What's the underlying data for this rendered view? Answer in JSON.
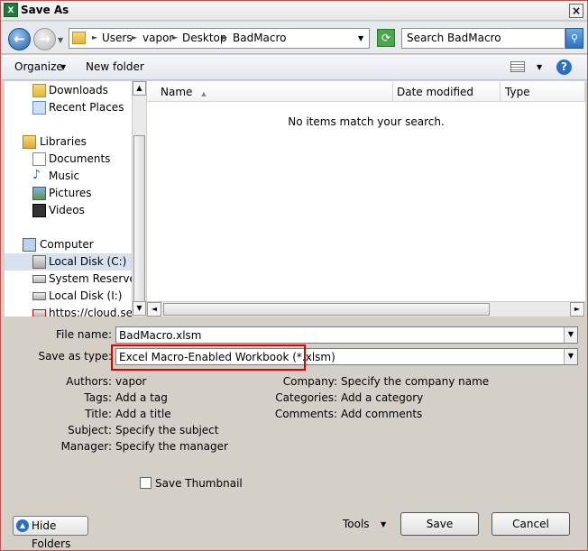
{
  "window": {
    "title": "Save As",
    "app_icon": "X"
  },
  "nav": {
    "path": [
      "Users",
      "vapor",
      "Desktop",
      "BadMacro"
    ],
    "search_placeholder": "Search BadMacro"
  },
  "toolbar": {
    "organize": "Organize",
    "new_folder": "New folder"
  },
  "nav_pane": {
    "items": [
      {
        "label": "Downloads",
        "icon": "downloads-folder-icon"
      },
      {
        "label": "Recent Places",
        "icon": "recent-places-icon"
      },
      {
        "label": "Libraries",
        "icon": "libraries-icon"
      },
      {
        "label": "Documents",
        "icon": "documents-icon"
      },
      {
        "label": "Music",
        "icon": "music-icon"
      },
      {
        "label": "Pictures",
        "icon": "pictures-icon"
      },
      {
        "label": "Videos",
        "icon": "videos-icon"
      },
      {
        "label": "Computer",
        "icon": "computer-icon"
      },
      {
        "label": "Local Disk (C:)",
        "icon": "local-disk-icon"
      },
      {
        "label": "System Reserved (",
        "icon": "drive-icon"
      },
      {
        "label": "Local Disk (I:)",
        "icon": "drive-icon"
      },
      {
        "label": "https://cloud.seve",
        "icon": "network-drive-icon"
      }
    ]
  },
  "columns": [
    "Name",
    "Date modified",
    "Type"
  ],
  "empty_message": "No items match your search.",
  "form": {
    "file_name_label": "File name:",
    "file_name_value": "BadMacro.xlsm",
    "save_type_label": "Save as type:",
    "save_type_value": "Excel Macro-Enabled Workbook (*.xlsm)"
  },
  "metadata": {
    "left": [
      {
        "label": "Authors:",
        "value": "vapor"
      },
      {
        "label": "Tags:",
        "value": "Add a tag"
      },
      {
        "label": "Title:",
        "value": "Add a title"
      },
      {
        "label": "Subject:",
        "value": "Specify the subject"
      },
      {
        "label": "Manager:",
        "value": "Specify the manager"
      }
    ],
    "right": [
      {
        "label": "Company:",
        "value": "Specify the company name"
      },
      {
        "label": "Categories:",
        "value": "Add a category"
      },
      {
        "label": "Comments:",
        "value": "Add comments"
      }
    ]
  },
  "save_thumbnail": {
    "label": "Save Thumbnail",
    "checked": false
  },
  "buttons": {
    "hide_folders": "Hide Folders",
    "tools": "Tools",
    "save": "Save",
    "cancel": "Cancel"
  },
  "colors": {
    "highlight": "#e00000",
    "selected_nav": "#d7e2ef"
  }
}
